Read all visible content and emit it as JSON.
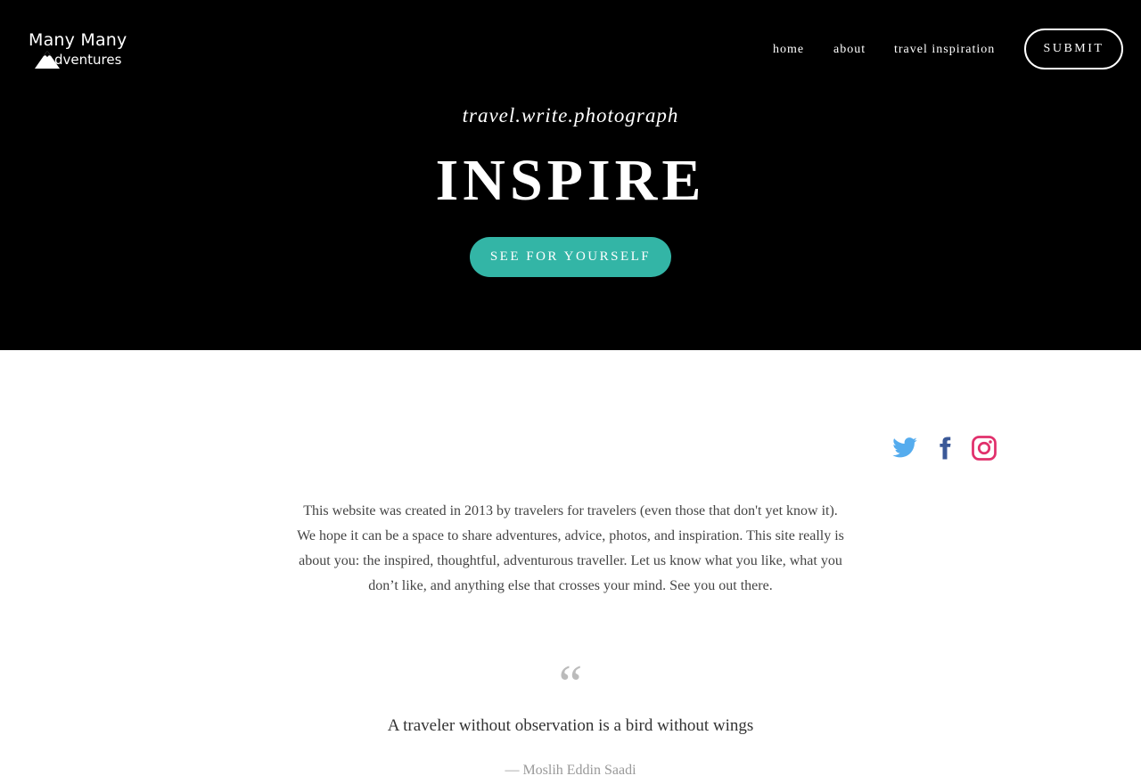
{
  "brand": {
    "logo_line1": "Many Many",
    "logo_line2": "dventures"
  },
  "nav": {
    "items": [
      {
        "label": "home"
      },
      {
        "label": "about"
      },
      {
        "label": "travel inspiration"
      }
    ],
    "submit_label": "SUBMIT"
  },
  "hero": {
    "tagline": "travel.write.photograph",
    "headline": "INSPIRE",
    "cta_label": "SEE FOR YOURSELF",
    "background_color": "#000000",
    "cta_color": "#33b5a6"
  },
  "social": {
    "icons": [
      {
        "name": "twitter-icon",
        "color": "#55acee"
      },
      {
        "name": "facebook-icon",
        "color": "#3b5998"
      },
      {
        "name": "instagram-icon",
        "color": "#e1306c"
      }
    ]
  },
  "about": {
    "text": "This website was created in 2013 by travelers for travelers (even those that don't yet know it). We hope it can be a space to share adventures, advice, photos, and inspiration. This site really is about you: the inspired, thoughtful, adventurous traveller. Let us know what you like, what you don’t like, and anything else that crosses your mind.  See you out there."
  },
  "quote": {
    "mark": "“",
    "text": "A traveler without observation is a bird without wings",
    "author": "— Moslih Eddin Saadi"
  }
}
